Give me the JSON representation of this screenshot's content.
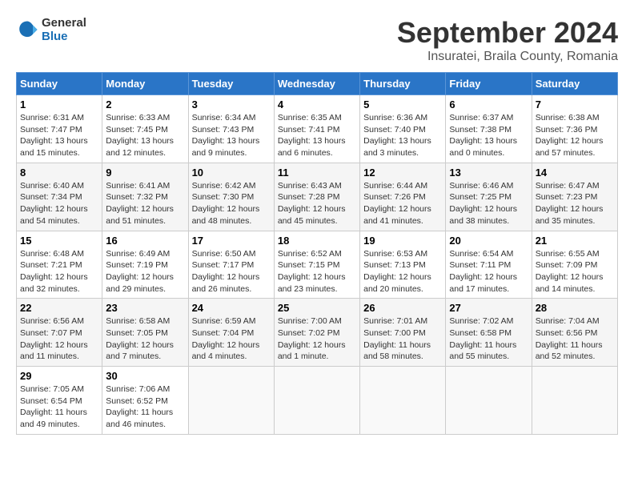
{
  "logo": {
    "line1": "General",
    "line2": "Blue"
  },
  "title": "September 2024",
  "subtitle": "Insuratei, Braila County, Romania",
  "headers": [
    "Sunday",
    "Monday",
    "Tuesday",
    "Wednesday",
    "Thursday",
    "Friday",
    "Saturday"
  ],
  "weeks": [
    [
      {
        "day": "1",
        "info": "Sunrise: 6:31 AM\nSunset: 7:47 PM\nDaylight: 13 hours\nand 15 minutes."
      },
      {
        "day": "2",
        "info": "Sunrise: 6:33 AM\nSunset: 7:45 PM\nDaylight: 13 hours\nand 12 minutes."
      },
      {
        "day": "3",
        "info": "Sunrise: 6:34 AM\nSunset: 7:43 PM\nDaylight: 13 hours\nand 9 minutes."
      },
      {
        "day": "4",
        "info": "Sunrise: 6:35 AM\nSunset: 7:41 PM\nDaylight: 13 hours\nand 6 minutes."
      },
      {
        "day": "5",
        "info": "Sunrise: 6:36 AM\nSunset: 7:40 PM\nDaylight: 13 hours\nand 3 minutes."
      },
      {
        "day": "6",
        "info": "Sunrise: 6:37 AM\nSunset: 7:38 PM\nDaylight: 13 hours\nand 0 minutes."
      },
      {
        "day": "7",
        "info": "Sunrise: 6:38 AM\nSunset: 7:36 PM\nDaylight: 12 hours\nand 57 minutes."
      }
    ],
    [
      {
        "day": "8",
        "info": "Sunrise: 6:40 AM\nSunset: 7:34 PM\nDaylight: 12 hours\nand 54 minutes."
      },
      {
        "day": "9",
        "info": "Sunrise: 6:41 AM\nSunset: 7:32 PM\nDaylight: 12 hours\nand 51 minutes."
      },
      {
        "day": "10",
        "info": "Sunrise: 6:42 AM\nSunset: 7:30 PM\nDaylight: 12 hours\nand 48 minutes."
      },
      {
        "day": "11",
        "info": "Sunrise: 6:43 AM\nSunset: 7:28 PM\nDaylight: 12 hours\nand 45 minutes."
      },
      {
        "day": "12",
        "info": "Sunrise: 6:44 AM\nSunset: 7:26 PM\nDaylight: 12 hours\nand 41 minutes."
      },
      {
        "day": "13",
        "info": "Sunrise: 6:46 AM\nSunset: 7:25 PM\nDaylight: 12 hours\nand 38 minutes."
      },
      {
        "day": "14",
        "info": "Sunrise: 6:47 AM\nSunset: 7:23 PM\nDaylight: 12 hours\nand 35 minutes."
      }
    ],
    [
      {
        "day": "15",
        "info": "Sunrise: 6:48 AM\nSunset: 7:21 PM\nDaylight: 12 hours\nand 32 minutes."
      },
      {
        "day": "16",
        "info": "Sunrise: 6:49 AM\nSunset: 7:19 PM\nDaylight: 12 hours\nand 29 minutes."
      },
      {
        "day": "17",
        "info": "Sunrise: 6:50 AM\nSunset: 7:17 PM\nDaylight: 12 hours\nand 26 minutes."
      },
      {
        "day": "18",
        "info": "Sunrise: 6:52 AM\nSunset: 7:15 PM\nDaylight: 12 hours\nand 23 minutes."
      },
      {
        "day": "19",
        "info": "Sunrise: 6:53 AM\nSunset: 7:13 PM\nDaylight: 12 hours\nand 20 minutes."
      },
      {
        "day": "20",
        "info": "Sunrise: 6:54 AM\nSunset: 7:11 PM\nDaylight: 12 hours\nand 17 minutes."
      },
      {
        "day": "21",
        "info": "Sunrise: 6:55 AM\nSunset: 7:09 PM\nDaylight: 12 hours\nand 14 minutes."
      }
    ],
    [
      {
        "day": "22",
        "info": "Sunrise: 6:56 AM\nSunset: 7:07 PM\nDaylight: 12 hours\nand 11 minutes."
      },
      {
        "day": "23",
        "info": "Sunrise: 6:58 AM\nSunset: 7:05 PM\nDaylight: 12 hours\nand 7 minutes."
      },
      {
        "day": "24",
        "info": "Sunrise: 6:59 AM\nSunset: 7:04 PM\nDaylight: 12 hours\nand 4 minutes."
      },
      {
        "day": "25",
        "info": "Sunrise: 7:00 AM\nSunset: 7:02 PM\nDaylight: 12 hours\nand 1 minute."
      },
      {
        "day": "26",
        "info": "Sunrise: 7:01 AM\nSunset: 7:00 PM\nDaylight: 11 hours\nand 58 minutes."
      },
      {
        "day": "27",
        "info": "Sunrise: 7:02 AM\nSunset: 6:58 PM\nDaylight: 11 hours\nand 55 minutes."
      },
      {
        "day": "28",
        "info": "Sunrise: 7:04 AM\nSunset: 6:56 PM\nDaylight: 11 hours\nand 52 minutes."
      }
    ],
    [
      {
        "day": "29",
        "info": "Sunrise: 7:05 AM\nSunset: 6:54 PM\nDaylight: 11 hours\nand 49 minutes."
      },
      {
        "day": "30",
        "info": "Sunrise: 7:06 AM\nSunset: 6:52 PM\nDaylight: 11 hours\nand 46 minutes."
      },
      {
        "day": "",
        "info": ""
      },
      {
        "day": "",
        "info": ""
      },
      {
        "day": "",
        "info": ""
      },
      {
        "day": "",
        "info": ""
      },
      {
        "day": "",
        "info": ""
      }
    ]
  ]
}
